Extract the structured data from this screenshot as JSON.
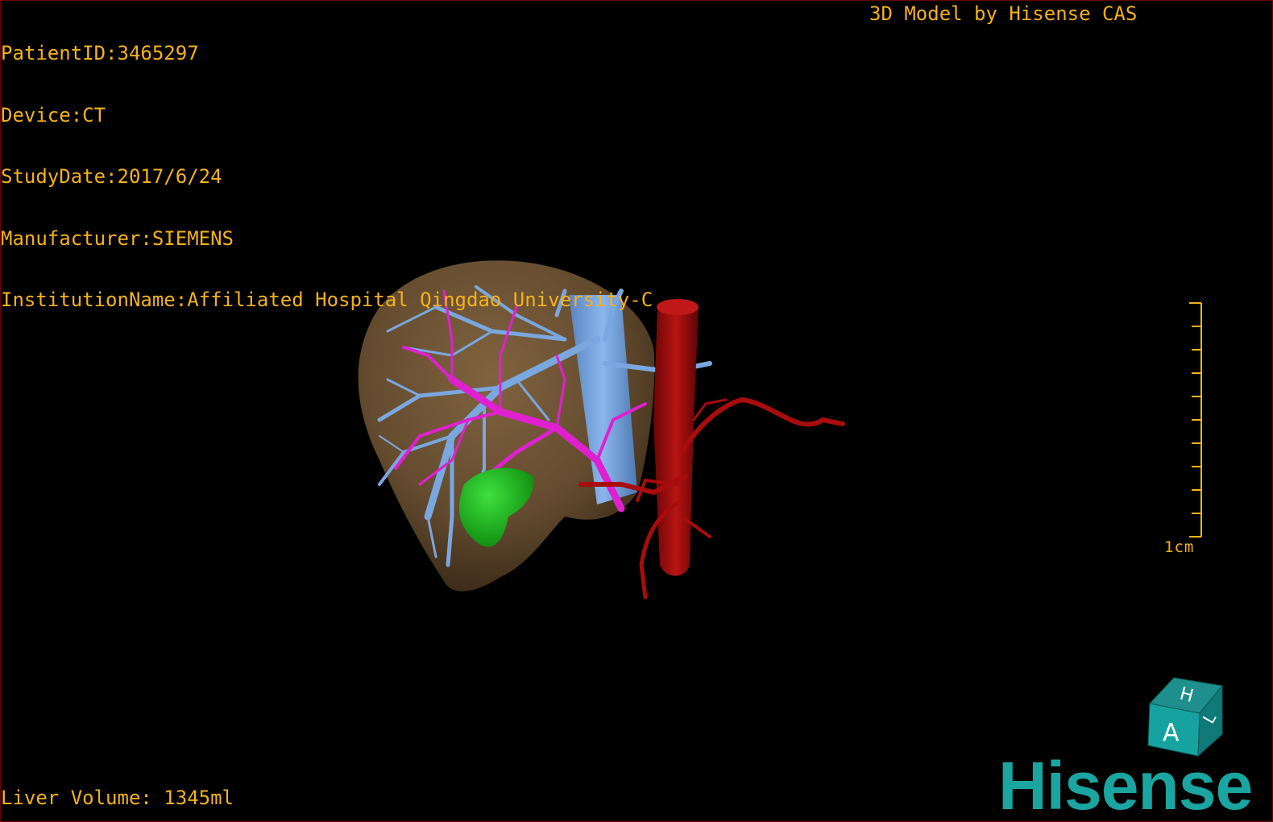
{
  "overlay": {
    "patient_id": "PatientID:3465297",
    "device": "Device:CT",
    "study_date": "StudyDate:2017/6/24",
    "manufacturer": "Manufacturer:SIEMENS",
    "institution": "InstitutionName:Affiliated Hospital Qingdao University-C",
    "model_credit": "3D Model by Hisense CAS",
    "liver_volume": "Liver Volume: 1345ml"
  },
  "scale_bar": {
    "label": "1cm",
    "tick_count": 11
  },
  "orientation_cube": {
    "front_face": "A",
    "top_face": "H",
    "side_face": "L"
  },
  "brand": {
    "logo_text": "Hisense"
  },
  "colors": {
    "overlay_text": "#f4b21a",
    "liver": "#7a5c3a",
    "hepatic_vein": "#7aa7e0",
    "portal_vein": "#e020d0",
    "artery": "#a00a0a",
    "tumor": "#1eb41e",
    "brand": "#1aa5a0"
  },
  "icons": {
    "orientation_cube": "orientation-cube-icon",
    "scale_bar": "ruler-icon"
  }
}
